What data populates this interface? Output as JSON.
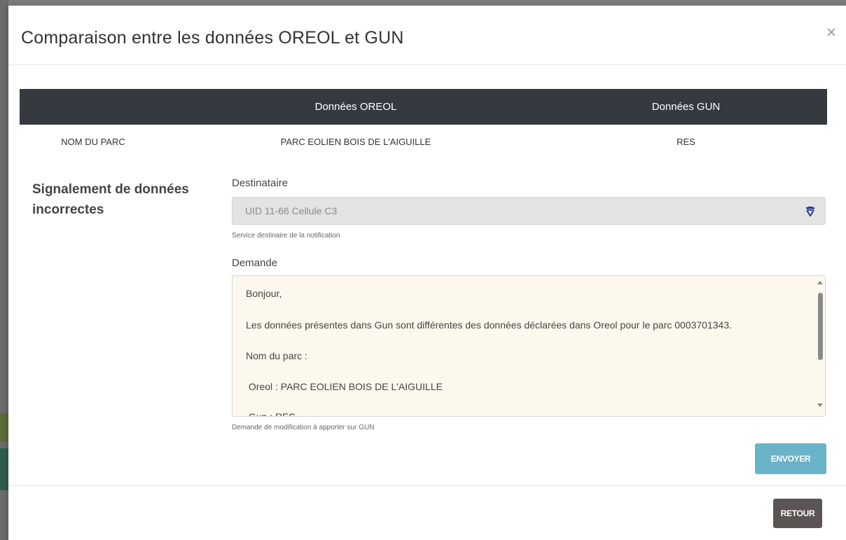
{
  "modal": {
    "title": "Comparaison entre les données OREOL et GUN",
    "close_symbol": "×"
  },
  "comparison_table": {
    "headers": [
      "",
      "Données OREOL",
      "Données GUN"
    ],
    "rows": [
      [
        "NOM DU PARC",
        "PARC EOLIEN BOIS DE L'AIGUILLE",
        "RES"
      ]
    ]
  },
  "report_section": {
    "title_line1": "Signalement de données",
    "title_line2": "incorrectes"
  },
  "recipient_field": {
    "label": "Destinataire",
    "value": "UID 11-66 Cellule C3",
    "help": "Service destinaire de la notification",
    "icon": "dropdown-brand-icon"
  },
  "request_field": {
    "label": "Demande",
    "lines": [
      "Bonjour,",
      "Les données présentes dans Gun sont différentes des données déclarées dans Oreol pour le parc 0003701343.",
      "Nom du parc :",
      " Oreol : PARC EOLIEN BOIS DE L'AIGUILLE",
      " Gun : RES"
    ],
    "help": "Demande de modification à apporter sur GUN"
  },
  "buttons": {
    "send": "ENVOYER",
    "back": "RETOUR"
  },
  "colors": {
    "table_header_bg": "#343a40",
    "send_button": "#6ab3c9",
    "back_button": "#5a5552",
    "textarea_bg": "#fdf8ee",
    "select_bg": "#e3e3e3"
  }
}
